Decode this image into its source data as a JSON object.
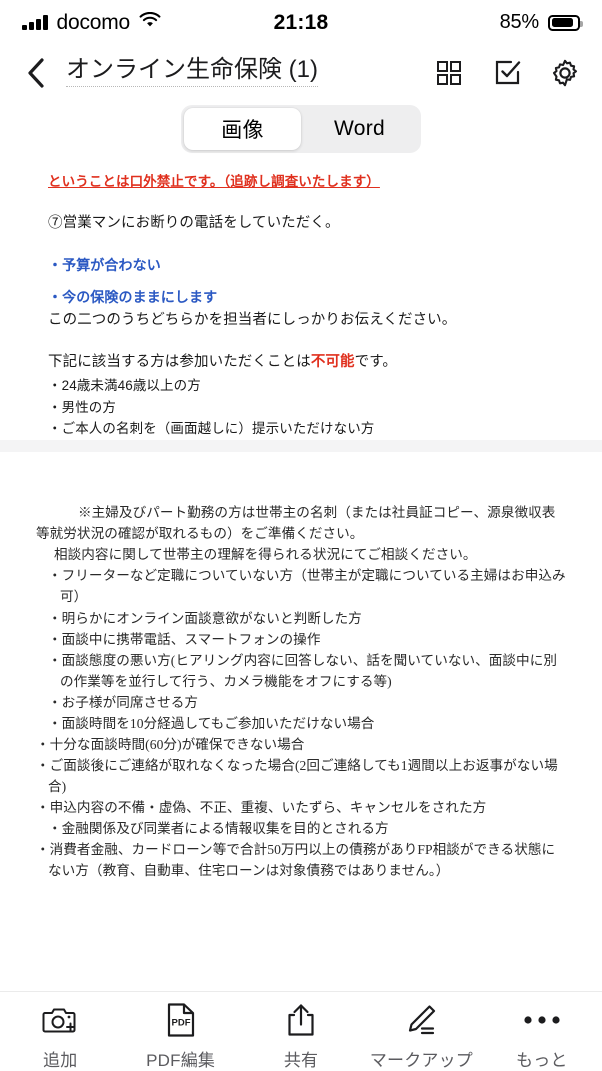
{
  "status_bar": {
    "carrier": "docomo",
    "time": "21:18",
    "battery_percent": "85%",
    "signal_icon": "signal-bars-icon",
    "wifi_icon": "wifi-icon",
    "battery_icon": "battery-icon"
  },
  "nav": {
    "back_icon": "chevron-left-icon",
    "title": "オンライン生命保険 (1)",
    "actions": [
      {
        "name": "grid-view-icon",
        "label": "grid-view"
      },
      {
        "name": "select-checkbox-icon",
        "label": "select"
      },
      {
        "name": "gear-icon",
        "label": "settings"
      }
    ]
  },
  "tabs": {
    "selected": "画像",
    "items": [
      {
        "label": "画像",
        "active": true
      },
      {
        "label": "Word",
        "active": false
      }
    ]
  },
  "document": {
    "page1": {
      "red_heading": "ということは口外禁止です。（追跡し調査いたします）",
      "line_item7": "⑦営業マンにお断りの電話をしていただく。",
      "blue_bullet1": "・予算が合わない",
      "blue_bullet2": "・今の保険のままにします",
      "line_confirm": "この二つのうちどちらかを担当者にしっかりお伝えください。",
      "notice_prefix": "下記に該当する方は参加いただくことは",
      "notice_emphasis": "不可能",
      "notice_suffix": "です。",
      "bullets": [
        "・24歳未満46歳以上の方",
        "・男性の方",
        "・ご本人の名刺を（画面越しに）提示いただけない方"
      ]
    },
    "page2": {
      "note1": "※主婦及びパート勤務の方は世帯主の名刺（または社員証コピー、源泉徴収表等就労状況の確認が取れるもの）をご準備ください。",
      "note2": "相談内容に関して世帯主の理解を得られる状況にてご相談ください。",
      "bullets": [
        "・フリーターなど定職についていない方（世帯主が定職についている主婦はお申込み可）",
        "・明らかにオンライン面談意欲がないと判断した方",
        "・面談中に携帯電話、スマートフォンの操作",
        "・面談態度の悪い方(ヒアリング内容に回答しない、話を聞いていない、面談中に別の作業等を並行して行う、カメラ機能をオフにする等)",
        "・お子様が同席させる方",
        "・面談時間を10分経過してもご参加いただけない場合",
        "・十分な面談時間(60分)が確保できない場合",
        "・ご面談後にご連絡が取れなくなった場合(2回ご連絡しても1週間以上お返事がない場合)",
        "・申込内容の不備・虚偽、不正、重複、いたずら、キャンセルをされた方",
        "・金融関係及び同業者による情報収集を目的とされる方",
        "・消費者金融、カードローン等で合計50万円以上の債務がありFP相談ができる状態にない方（教育、自動車、住宅ローンは対象債務ではありません。）"
      ]
    }
  },
  "toolbar": {
    "items": [
      {
        "icon": "camera-add-icon",
        "label": "追加"
      },
      {
        "icon": "pdf-file-icon",
        "label": "PDF編集"
      },
      {
        "icon": "share-icon",
        "label": "共有"
      },
      {
        "icon": "pencil-markup-icon",
        "label": "マークアップ"
      },
      {
        "icon": "ellipsis-icon",
        "label": "もっと"
      }
    ]
  },
  "colors": {
    "accent_red": "#e0301e",
    "accent_blue": "#2b59c3",
    "page_background": "#f4f4f5"
  }
}
